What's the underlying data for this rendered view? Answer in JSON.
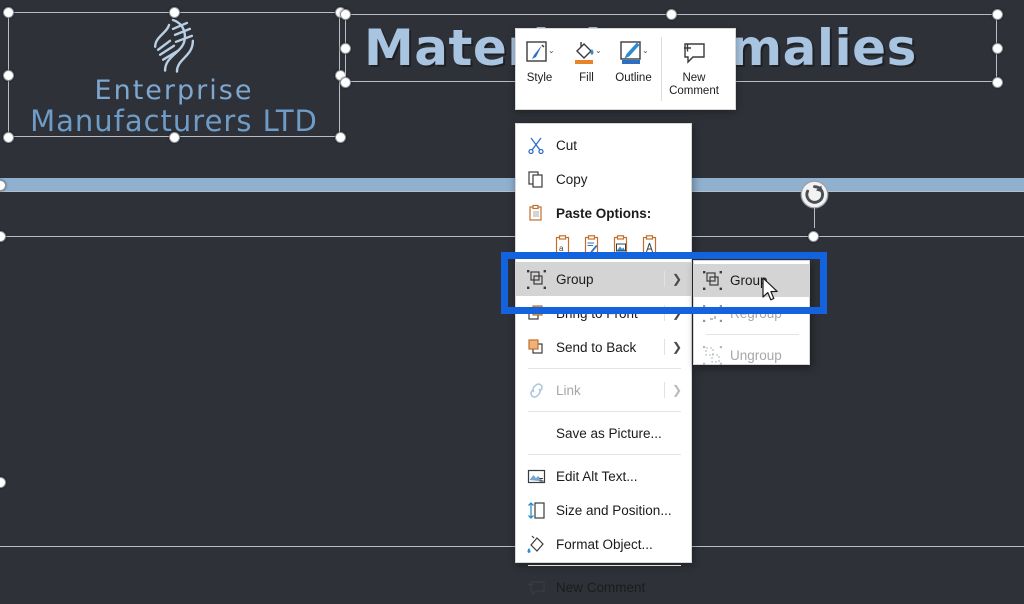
{
  "app": "powerpoint-slide-editor",
  "slide": {
    "background_color": "#2e3238",
    "logo": {
      "icon": "dna-helix-icon",
      "line1": "Enterprise",
      "line2": "Manufacturers LTD",
      "text_color": "#7ea7cf"
    },
    "title": {
      "text": "Material Anomalies",
      "color": "#a8c4e0"
    },
    "accent_bar_color": "#8fb0cf",
    "selection_handle_color": "#ffffff",
    "rotation_handle": "rotate-handle-icon"
  },
  "mini_toolbar": {
    "items": [
      {
        "label": "Style",
        "icon": "style-brush-icon",
        "has_dropdown": true
      },
      {
        "label": "Fill",
        "icon": "paint-bucket-icon",
        "has_dropdown": true,
        "swatch": "#e8832a"
      },
      {
        "label": "Outline",
        "icon": "outline-pencil-icon",
        "has_dropdown": true,
        "swatch": "#2e6fc4"
      },
      {
        "label": "New\nComment",
        "label_line1": "New",
        "label_line2": "Comment",
        "icon": "new-comment-icon",
        "has_dropdown": false
      }
    ]
  },
  "context_menu": {
    "items": [
      {
        "id": "cut",
        "label": "Cut",
        "mnemonic": "t",
        "icon": "scissors-icon",
        "disabled": false,
        "submenu": false
      },
      {
        "id": "copy",
        "label": "Copy",
        "mnemonic": "C",
        "icon": "copy-icon",
        "disabled": false,
        "submenu": false
      },
      {
        "id": "paste-options",
        "label": "Paste Options:",
        "icon": "clipboard-icon",
        "disabled": false,
        "submenu": false,
        "bold": true
      }
    ],
    "paste_options": [
      {
        "id": "paste-keep-source",
        "icon": "clipboard-a-icon"
      },
      {
        "id": "paste-keep-formatting",
        "icon": "clipboard-pen-icon"
      },
      {
        "id": "paste-picture",
        "icon": "clipboard-picture-icon"
      },
      {
        "id": "paste-text-only",
        "icon": "clipboard-text-icon"
      }
    ],
    "items2": [
      {
        "id": "group",
        "label": "Group",
        "mnemonic": "G",
        "icon": "group-icon",
        "disabled": false,
        "submenu": true,
        "highlighted": true
      },
      {
        "id": "bring-to-front",
        "label": "Bring to Front",
        "mnemonic": "R",
        "icon": "bring-front-icon",
        "disabled": false,
        "submenu": true
      },
      {
        "id": "send-to-back",
        "label": "Send to Back",
        "mnemonic": "k",
        "icon": "send-back-icon",
        "disabled": false,
        "submenu": true
      },
      {
        "id": "link",
        "label": "Link",
        "mnemonic": "i",
        "icon": "link-icon",
        "disabled": true,
        "submenu": true
      }
    ],
    "items3": [
      {
        "id": "save-as-picture",
        "label": "Save as Picture...",
        "mnemonic": "S",
        "icon": "",
        "disabled": false,
        "submenu": false
      },
      {
        "id": "edit-alt-text",
        "label": "Edit Alt Text...",
        "mnemonic": "A",
        "icon": "alt-text-icon",
        "disabled": false,
        "submenu": false
      },
      {
        "id": "size-and-position",
        "label": "Size and Position...",
        "mnemonic": "z",
        "icon": "size-position-icon",
        "disabled": false,
        "submenu": false
      },
      {
        "id": "format-object",
        "label": "Format Object...",
        "mnemonic": "o",
        "icon": "format-object-icon",
        "disabled": false,
        "submenu": false
      },
      {
        "id": "new-comment",
        "label": "New Comment",
        "mnemonic": "m",
        "icon": "new-comment-icon",
        "disabled": false,
        "submenu": false
      }
    ]
  },
  "submenu": {
    "items": [
      {
        "id": "group",
        "label": "Group",
        "mnemonic": "G",
        "icon": "group-icon",
        "disabled": false,
        "highlighted": true
      },
      {
        "id": "regroup",
        "label": "Regroup",
        "mnemonic": "e",
        "icon": "regroup-icon",
        "disabled": true
      },
      {
        "id": "ungroup",
        "label": "Ungroup",
        "mnemonic": "U",
        "icon": "ungroup-icon",
        "disabled": true
      }
    ]
  },
  "annotation": {
    "color": "#1363df",
    "shape": "rectangle-highlight"
  }
}
